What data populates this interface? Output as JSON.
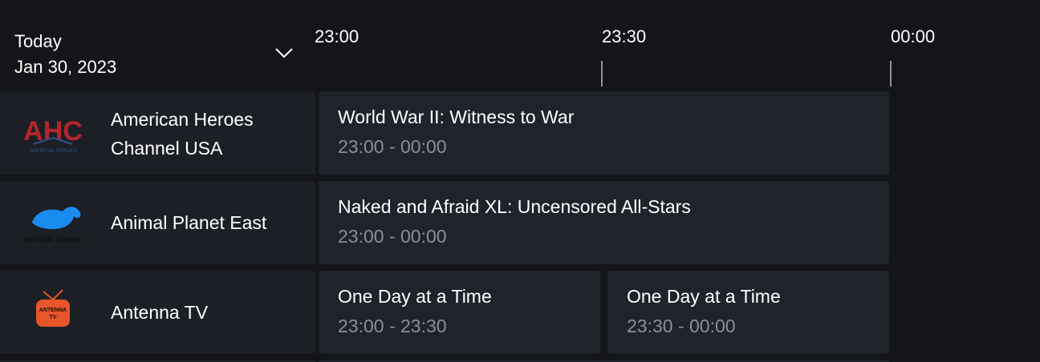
{
  "date_picker": {
    "day": "Today",
    "date": "Jan 30, 2023"
  },
  "timeline": [
    "23:00",
    "23:30",
    "00:00"
  ],
  "channels": [
    {
      "name_line1": "American Heroes",
      "name_line2": "Channel USA",
      "logo": {
        "text": "AHC",
        "subtext": "AMERICAN HEROES",
        "color": "#b3262e"
      },
      "programs": [
        {
          "title": "World War II: Witness to War",
          "time": "23:00 - 00:00"
        }
      ]
    },
    {
      "name_line1": "Animal Planet East",
      "logo": {
        "text": "animal planet",
        "color": "#1a8cf0"
      },
      "programs": [
        {
          "title": "Naked and Afraid XL: Uncensored All-Stars",
          "time": "23:00 - 00:00"
        }
      ]
    },
    {
      "name_line1": "Antenna TV",
      "logo": {
        "text": "ANTENNA",
        "subtext": "TV",
        "color": "#e8552a"
      },
      "programs": [
        {
          "title": "One Day at a Time",
          "time": "23:00 - 23:30"
        },
        {
          "title": "One Day at a Time",
          "time": "23:30 - 00:00"
        }
      ]
    }
  ],
  "colors": {
    "background": "#141519",
    "channel_cell": "#1c1f25",
    "program_cell": "#1f232b",
    "muted_text": "#8a8f98"
  }
}
